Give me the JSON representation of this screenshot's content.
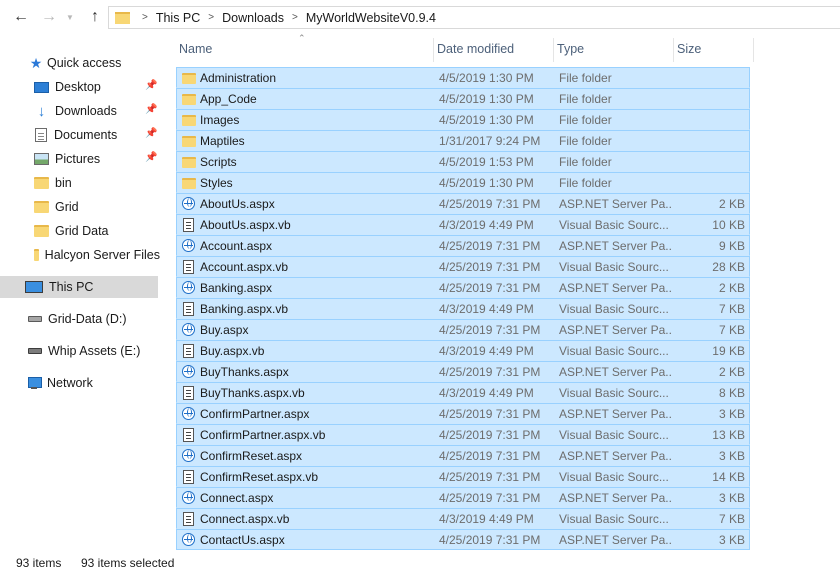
{
  "navigation": {
    "back_icon": "arrow-left-icon",
    "forward_icon": "arrow-right-icon",
    "recent_icon": "chevron-down-icon",
    "up_icon": "arrow-up-icon"
  },
  "address_bar": {
    "crumbs": [
      "This PC",
      "Downloads",
      "MyWorldWebsiteV0.9.4"
    ],
    "separator": ">"
  },
  "sidebar": {
    "quick_access": "Quick access",
    "items": [
      {
        "label": "Desktop",
        "icon": "desktop-icon",
        "pinned": true
      },
      {
        "label": "Downloads",
        "icon": "download-icon",
        "pinned": true
      },
      {
        "label": "Documents",
        "icon": "document-icon",
        "pinned": true
      },
      {
        "label": "Pictures",
        "icon": "picture-icon",
        "pinned": true
      },
      {
        "label": "bin",
        "icon": "folder-icon",
        "pinned": false
      },
      {
        "label": "Grid",
        "icon": "folder-icon",
        "pinned": false
      },
      {
        "label": "Grid Data",
        "icon": "folder-icon",
        "pinned": false
      },
      {
        "label": "Halcyon Server Files",
        "icon": "folder-icon",
        "pinned": false
      }
    ],
    "this_pc": "This PC",
    "drives": [
      {
        "label": "Grid-Data (D:)",
        "icon": "drive-icon"
      },
      {
        "label": "Whip Assets (E:)",
        "icon": "drive-icon"
      }
    ],
    "network": "Network"
  },
  "columns": {
    "name": "Name",
    "date": "Date modified",
    "type": "Type",
    "size": "Size"
  },
  "files": [
    {
      "name": "Administration",
      "date": "4/5/2019 1:30 PM",
      "type": "File folder",
      "size": "",
      "icon": "folder-icon"
    },
    {
      "name": "App_Code",
      "date": "4/5/2019 1:30 PM",
      "type": "File folder",
      "size": "",
      "icon": "folder-icon"
    },
    {
      "name": "Images",
      "date": "4/5/2019 1:30 PM",
      "type": "File folder",
      "size": "",
      "icon": "folder-icon"
    },
    {
      "name": "Maptiles",
      "date": "1/31/2017 9:24 PM",
      "type": "File folder",
      "size": "",
      "icon": "folder-icon"
    },
    {
      "name": "Scripts",
      "date": "4/5/2019 1:53 PM",
      "type": "File folder",
      "size": "",
      "icon": "folder-icon"
    },
    {
      "name": "Styles",
      "date": "4/5/2019 1:30 PM",
      "type": "File folder",
      "size": "",
      "icon": "folder-icon"
    },
    {
      "name": "AboutUs.aspx",
      "date": "4/25/2019 7:31 PM",
      "type": "ASP.NET Server Pa...",
      "size": "2 KB",
      "icon": "aspx-icon"
    },
    {
      "name": "AboutUs.aspx.vb",
      "date": "4/3/2019 4:49 PM",
      "type": "Visual Basic Sourc...",
      "size": "10 KB",
      "icon": "vb-source-icon"
    },
    {
      "name": "Account.aspx",
      "date": "4/25/2019 7:31 PM",
      "type": "ASP.NET Server Pa...",
      "size": "9 KB",
      "icon": "aspx-icon"
    },
    {
      "name": "Account.aspx.vb",
      "date": "4/25/2019 7:31 PM",
      "type": "Visual Basic Sourc...",
      "size": "28 KB",
      "icon": "vb-source-icon"
    },
    {
      "name": "Banking.aspx",
      "date": "4/25/2019 7:31 PM",
      "type": "ASP.NET Server Pa...",
      "size": "2 KB",
      "icon": "aspx-icon"
    },
    {
      "name": "Banking.aspx.vb",
      "date": "4/3/2019 4:49 PM",
      "type": "Visual Basic Sourc...",
      "size": "7 KB",
      "icon": "vb-source-icon"
    },
    {
      "name": "Buy.aspx",
      "date": "4/25/2019 7:31 PM",
      "type": "ASP.NET Server Pa...",
      "size": "7 KB",
      "icon": "aspx-icon"
    },
    {
      "name": "Buy.aspx.vb",
      "date": "4/3/2019 4:49 PM",
      "type": "Visual Basic Sourc...",
      "size": "19 KB",
      "icon": "vb-source-icon"
    },
    {
      "name": "BuyThanks.aspx",
      "date": "4/25/2019 7:31 PM",
      "type": "ASP.NET Server Pa...",
      "size": "2 KB",
      "icon": "aspx-icon"
    },
    {
      "name": "BuyThanks.aspx.vb",
      "date": "4/3/2019 4:49 PM",
      "type": "Visual Basic Sourc...",
      "size": "8 KB",
      "icon": "vb-source-icon"
    },
    {
      "name": "ConfirmPartner.aspx",
      "date": "4/25/2019 7:31 PM",
      "type": "ASP.NET Server Pa...",
      "size": "3 KB",
      "icon": "aspx-icon"
    },
    {
      "name": "ConfirmPartner.aspx.vb",
      "date": "4/25/2019 7:31 PM",
      "type": "Visual Basic Sourc...",
      "size": "13 KB",
      "icon": "vb-source-icon"
    },
    {
      "name": "ConfirmReset.aspx",
      "date": "4/25/2019 7:31 PM",
      "type": "ASP.NET Server Pa...",
      "size": "3 KB",
      "icon": "aspx-icon"
    },
    {
      "name": "ConfirmReset.aspx.vb",
      "date": "4/25/2019 7:31 PM",
      "type": "Visual Basic Sourc...",
      "size": "14 KB",
      "icon": "vb-source-icon"
    },
    {
      "name": "Connect.aspx",
      "date": "4/25/2019 7:31 PM",
      "type": "ASP.NET Server Pa...",
      "size": "3 KB",
      "icon": "aspx-icon"
    },
    {
      "name": "Connect.aspx.vb",
      "date": "4/3/2019 4:49 PM",
      "type": "Visual Basic Sourc...",
      "size": "7 KB",
      "icon": "vb-source-icon"
    },
    {
      "name": "ContactUs.aspx",
      "date": "4/25/2019 7:31 PM",
      "type": "ASP.NET Server Pa...",
      "size": "3 KB",
      "icon": "aspx-icon"
    }
  ],
  "status_bar": {
    "item_count": "93 items",
    "selected_count": "93 items selected"
  },
  "colors": {
    "selection_fill": "#cce8ff",
    "selection_border": "#99d1ff",
    "header_text": "#4c607a",
    "nav_selected": "#d9d9d9"
  }
}
